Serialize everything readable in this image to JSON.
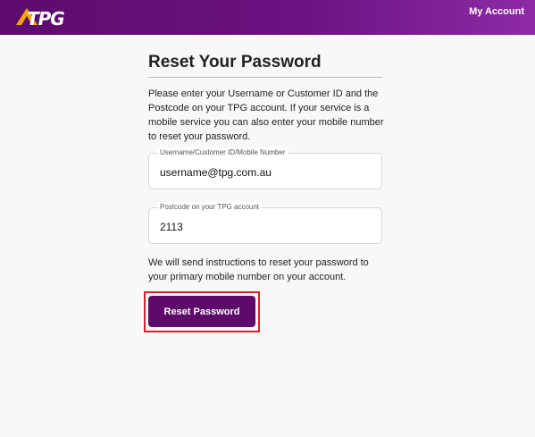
{
  "header": {
    "logo_text": "TPG",
    "my_account_label": "My Account",
    "accent_color": "#5d0b6e",
    "logo_accent_color": "#f6a500"
  },
  "main": {
    "title": "Reset Your Password",
    "intro": "Please enter your Username or Customer ID and the Postcode on your TPG account. If your service is a mobile service you can also enter your mobile number to reset your password.",
    "fields": [
      {
        "label": "Username/Customer ID/Mobile Number",
        "value": "username@tpg.com.au"
      },
      {
        "label": "Postcode on your TPG account",
        "value": "2113"
      }
    ],
    "note": "We will send instructions to reset your password to your primary mobile number on your account.",
    "reset_button_label": "Reset Password",
    "highlight_color": "#d8202a"
  }
}
